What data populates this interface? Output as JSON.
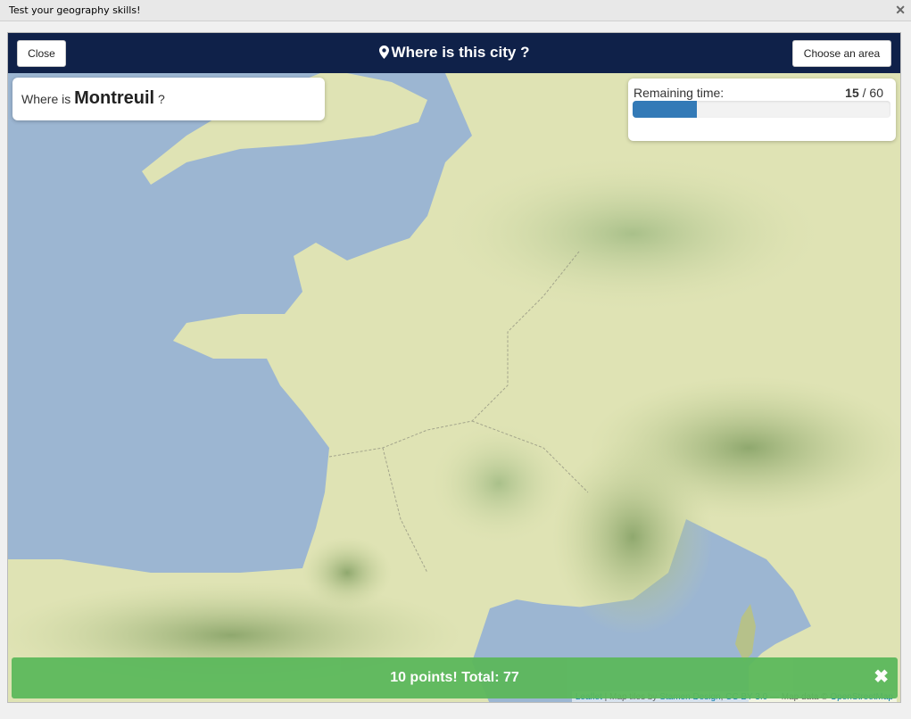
{
  "window": {
    "title": "Test your geography skills!"
  },
  "header": {
    "close_label": "Close",
    "title": "Where is this city ?",
    "area_label": "Choose an area"
  },
  "question": {
    "prefix": "Where is",
    "city": "Montreuil",
    "suffix": "?"
  },
  "timer": {
    "label": "Remaining time:",
    "current": "15",
    "separator": "/",
    "total": "60",
    "progress": 0.25
  },
  "score": {
    "message": "10 points!  Total: 77"
  },
  "attribution": {
    "leaflet": "Leaflet",
    "sep": " | Map tiles by ",
    "stamen": "Stamen Design",
    "comma": ", ",
    "cc": "CC BY 3.0",
    "dash": " — Map data © ",
    "osm": "OpenStreetMap"
  },
  "colors": {
    "header": "#0f2149",
    "progress": "#337ab7",
    "score": "#5cb85c",
    "sea": "#9cb6d2",
    "land": "#dfe3b4"
  },
  "icons": {
    "title_icon": "map-marker-icon",
    "dismiss_icon": "close-icon"
  }
}
